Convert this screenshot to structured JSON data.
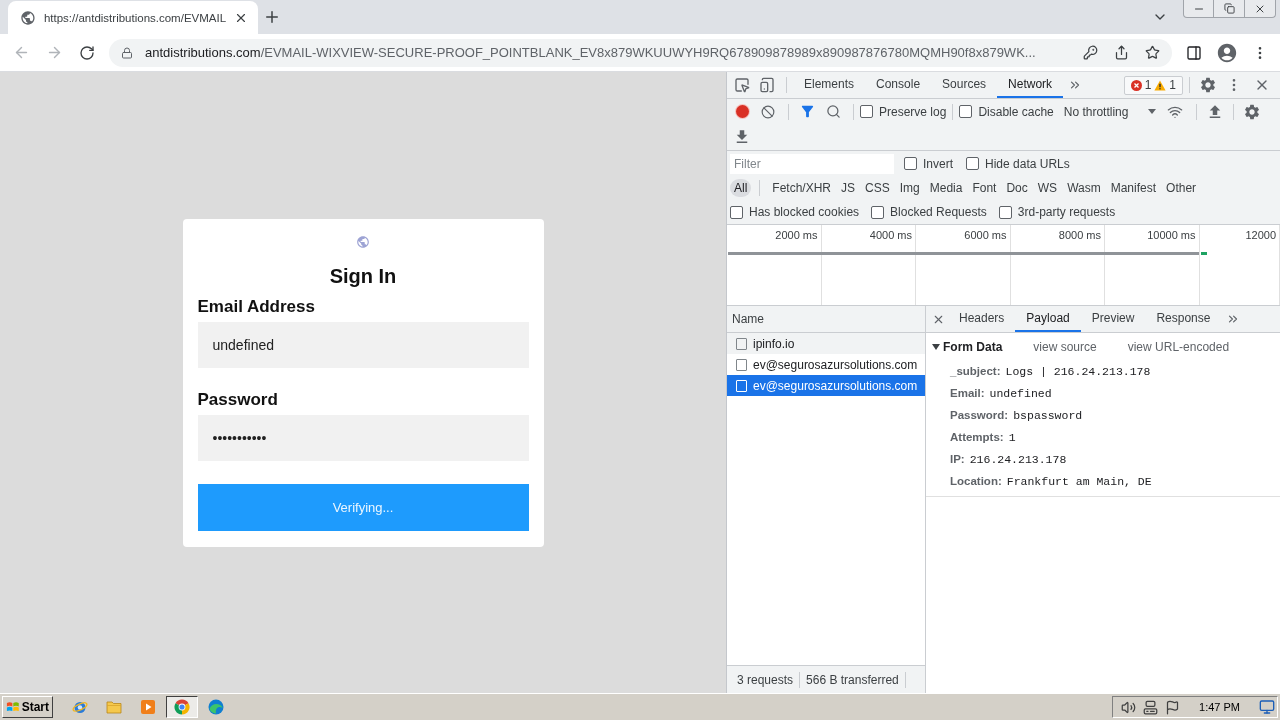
{
  "browser": {
    "tabs": [
      {
        "title": "https://antdistributions.com/EVMAIL",
        "selected": true
      }
    ],
    "url": {
      "host": "antdistributions.com",
      "path": "/EVMAIL-WIXVIEW-SECURE-PROOF_POINTBLANK_EV8x879WKUUWYH9RQ678909878989x890987876780MQMH90f8x879WK..."
    }
  },
  "login": {
    "title": "Sign In",
    "fields": [
      {
        "label": "Email Address",
        "value": "undefined"
      },
      {
        "label": "Password",
        "value": "•••••••••••"
      }
    ],
    "button": "Verifying..."
  },
  "devtools": {
    "tabs": [
      {
        "label": "Elements",
        "selected": false
      },
      {
        "label": "Console",
        "selected": false
      },
      {
        "label": "Sources",
        "selected": false
      },
      {
        "label": "Network",
        "selected": true
      }
    ],
    "issues": {
      "errors": "1",
      "warnings": "1"
    },
    "recording": true,
    "toolbar_options": [
      {
        "label": "Preserve log",
        "checked": false
      },
      {
        "label": "Disable cache",
        "checked": false
      }
    ],
    "throttling": "No throttling",
    "filter": {
      "placeholder": "Filter",
      "options": [
        {
          "label": "Invert",
          "checked": false
        },
        {
          "label": "Hide data URLs",
          "checked": false
        }
      ]
    },
    "types": [
      {
        "label": "All",
        "selected": true
      },
      {
        "label": "Fetch/XHR",
        "selected": false
      },
      {
        "label": "JS",
        "selected": false
      },
      {
        "label": "CSS",
        "selected": false
      },
      {
        "label": "Img",
        "selected": false
      },
      {
        "label": "Media",
        "selected": false
      },
      {
        "label": "Font",
        "selected": false
      },
      {
        "label": "Doc",
        "selected": false
      },
      {
        "label": "WS",
        "selected": false
      },
      {
        "label": "Wasm",
        "selected": false
      },
      {
        "label": "Manifest",
        "selected": false
      },
      {
        "label": "Other",
        "selected": false
      }
    ],
    "request_filters": [
      {
        "label": "Has blocked cookies",
        "checked": false
      },
      {
        "label": "Blocked Requests",
        "checked": false
      },
      {
        "label": "3rd-party requests",
        "checked": false
      }
    ],
    "overview": {
      "ticks": [
        "2000 ms",
        "4000 ms",
        "6000 ms",
        "8000 ms",
        "10000 ms",
        "12000"
      ]
    },
    "requests": {
      "column": "Name",
      "rows": [
        {
          "name": "ipinfo.io",
          "hovered": true,
          "selected": false
        },
        {
          "name": "ev@segurosazursolutions.com",
          "hovered": false,
          "selected": false
        },
        {
          "name": "ev@segurosazursolutions.com",
          "hovered": false,
          "selected": true
        }
      ],
      "summary": [
        "3 requests",
        "566 B transferred"
      ]
    },
    "detail": {
      "tabs": [
        {
          "label": "Headers",
          "selected": false
        },
        {
          "label": "Payload",
          "selected": true
        },
        {
          "label": "Preview",
          "selected": false
        },
        {
          "label": "Response",
          "selected": false
        }
      ],
      "section": {
        "title": "Form Data",
        "expanded": true,
        "links": [
          "view source",
          "view URL-encoded"
        ],
        "fields": [
          {
            "key": "_subject:",
            "value": "Logs | 216.24.213.178"
          },
          {
            "key": "Email:",
            "value": "undefined"
          },
          {
            "key": "Password:",
            "value": "bspassword"
          },
          {
            "key": "Attempts:",
            "value": "1"
          },
          {
            "key": "IP:",
            "value": "216.24.213.178"
          },
          {
            "key": "Location:",
            "value": "Frankfurt am Main, DE"
          }
        ]
      }
    }
  },
  "taskbar": {
    "start": "Start",
    "apps": [
      {
        "kind": "sphere",
        "active": false
      },
      {
        "kind": "folder",
        "active": false
      },
      {
        "kind": "player",
        "active": false
      },
      {
        "kind": "browser",
        "active": true
      },
      {
        "kind": "wave",
        "active": false
      }
    ],
    "clock": "1:47 PM"
  }
}
